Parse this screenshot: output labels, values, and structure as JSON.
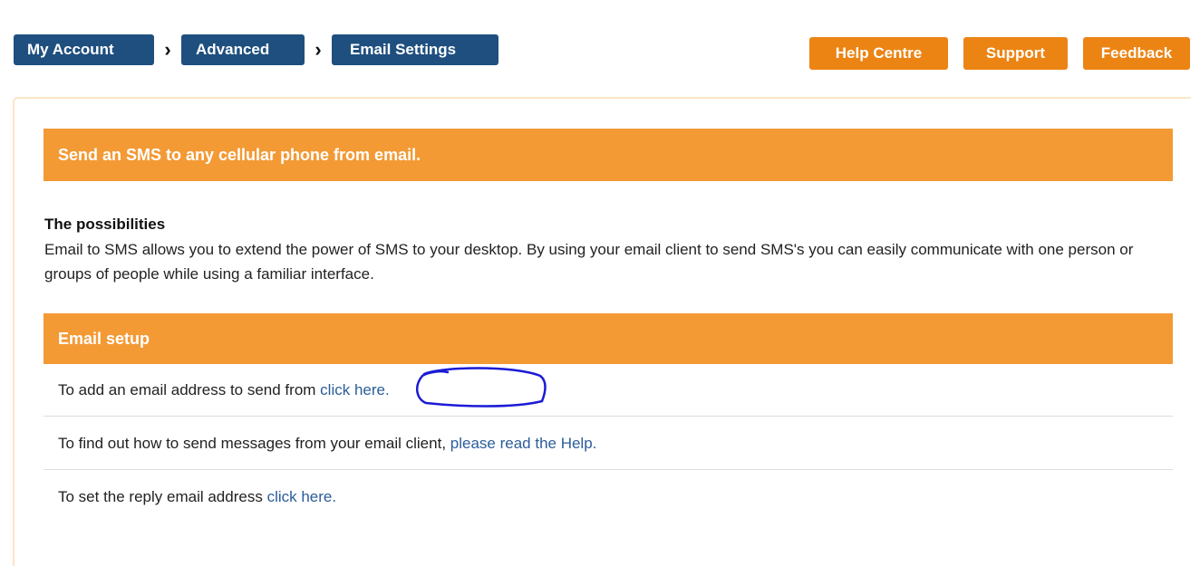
{
  "breadcrumb": {
    "items": [
      {
        "label": "My Account"
      },
      {
        "label": "Advanced"
      },
      {
        "label": "Email Settings"
      }
    ],
    "separator": "›"
  },
  "actions": {
    "help": "Help Centre",
    "support": "Support",
    "feedback": "Feedback"
  },
  "main": {
    "banner_title": "Send an SMS to any cellular phone from email.",
    "possibilities_title": "The possibilities",
    "possibilities_text": "Email to SMS allows you to extend the power of SMS to your desktop. By using your email client to send SMS's you can easily communicate with one person or groups of people while using a familiar interface.",
    "setup_title": "Email setup",
    "rows": [
      {
        "text": "To add an email address to send from",
        "link": "click here."
      },
      {
        "text": "To find out how to send messages from your email client,",
        "link": "please read the Help."
      },
      {
        "text": "To set the reply email address",
        "link": "click here."
      }
    ]
  },
  "colors": {
    "breadcrumb_bg": "#1e4f7e",
    "action_bg": "#ec8414",
    "banner_bg": "#f39a35",
    "link": "#2b5d9a",
    "annotation": "#1b1bd6"
  }
}
